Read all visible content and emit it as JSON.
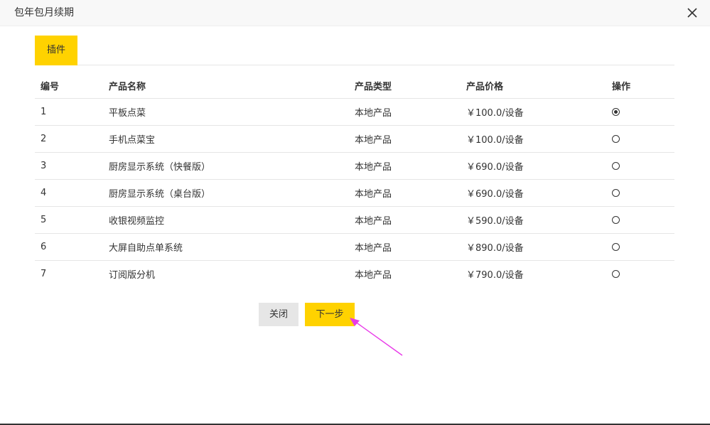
{
  "dialog": {
    "title": "包年包月续期",
    "close_icon": "close-icon"
  },
  "tabs": [
    {
      "label": "插件",
      "active": true
    }
  ],
  "table": {
    "headers": [
      "编号",
      "产品名称",
      "产品类型",
      "产品价格",
      "操作"
    ],
    "rows": [
      {
        "id": "1",
        "name": "平板点菜",
        "type": "本地产品",
        "price": "￥100.0/设备",
        "selected": true
      },
      {
        "id": "2",
        "name": "手机点菜宝",
        "type": "本地产品",
        "price": "￥100.0/设备",
        "selected": false
      },
      {
        "id": "3",
        "name": "厨房显示系统（快餐版）",
        "type": "本地产品",
        "price": "￥690.0/设备",
        "selected": false
      },
      {
        "id": "4",
        "name": "厨房显示系统（桌台版）",
        "type": "本地产品",
        "price": "￥690.0/设备",
        "selected": false
      },
      {
        "id": "5",
        "name": "收银视频监控",
        "type": "本地产品",
        "price": "￥590.0/设备",
        "selected": false
      },
      {
        "id": "6",
        "name": "大屏自助点单系统",
        "type": "本地产品",
        "price": "￥890.0/设备",
        "selected": false
      },
      {
        "id": "7",
        "name": "订阅版分机",
        "type": "本地产品",
        "price": "￥790.0/设备",
        "selected": false
      }
    ]
  },
  "buttons": {
    "close_label": "关闭",
    "next_label": "下一步"
  },
  "colors": {
    "accent": "#ffd200",
    "secondary_button": "#e6e6e6",
    "annotation_arrow": "#e83ae8"
  }
}
